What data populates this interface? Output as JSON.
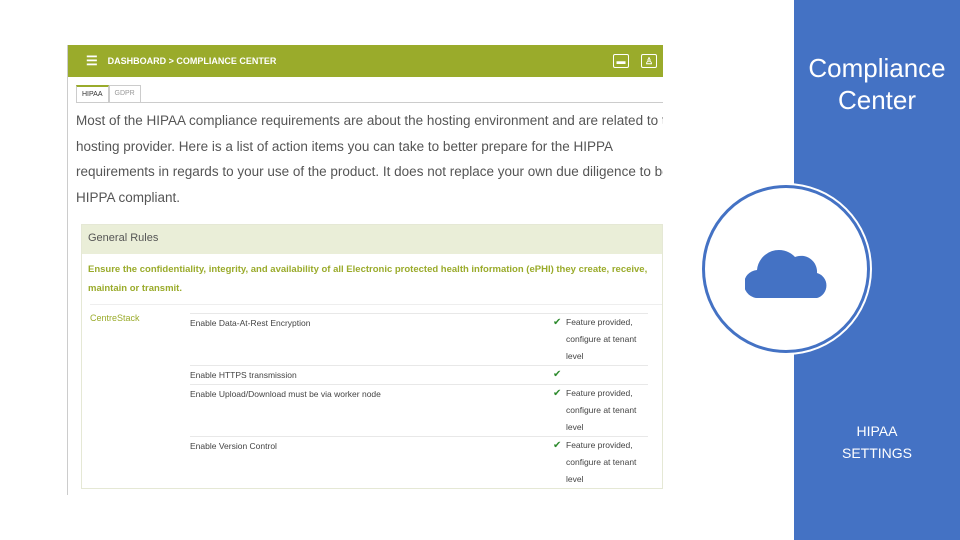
{
  "app": {
    "breadcrumb": "DASHBOARD > COMPLIANCE CENTER",
    "tabs": [
      "HIPAA",
      "GDPR"
    ],
    "intro": "Most of the HIPAA compliance requirements are about the hosting environment and are related to the hosting provider. Here is a list of action items you can take to better prepare for the HIPPA requirements in regards to your use of the product. It does not replace your own due diligence to be HIPPA compliant.",
    "panel_title": "General Rules",
    "rule": "Ensure the confidentiality, integrity, and availability of all Electronic protected health information (ePHI) they create, receive, maintain or transmit.",
    "provider": "CentreStack",
    "items": [
      {
        "name": "Enable Data-At-Rest Encryption",
        "status": "Feature provided, configure at tenant level"
      },
      {
        "name": "Enable HTTPS transmission",
        "status": ""
      },
      {
        "name": "Enable Upload/Download must be via worker node",
        "status": "Feature provided, configure at tenant level"
      },
      {
        "name": "Enable Version Control",
        "status": "Feature provided, configure at tenant level"
      }
    ]
  },
  "side": {
    "title": "Compliance Center",
    "label_1": "HIPAA",
    "label_2": "SETTINGS"
  }
}
